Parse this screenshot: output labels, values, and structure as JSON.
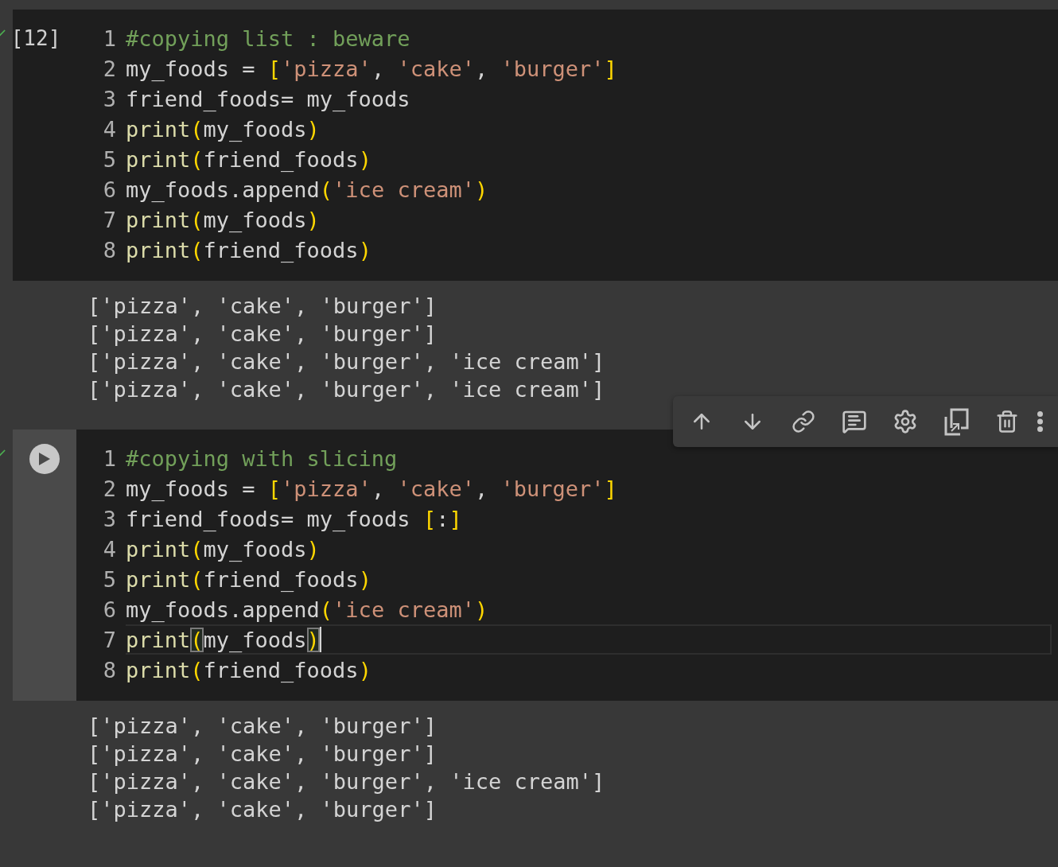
{
  "cells": [
    {
      "execution_count": "[12]",
      "run_button": false,
      "lines": [
        {
          "number": "1",
          "active": false,
          "cursor": false,
          "tokens": [
            {
              "kind": "comment",
              "text": "#copying list : beware"
            }
          ]
        },
        {
          "number": "2",
          "active": false,
          "cursor": false,
          "tokens": [
            {
              "kind": "plain",
              "text": "my_foods = "
            },
            {
              "kind": "bracket",
              "text": "["
            },
            {
              "kind": "string",
              "text": "'pizza'"
            },
            {
              "kind": "plain",
              "text": ", "
            },
            {
              "kind": "string",
              "text": "'cake'"
            },
            {
              "kind": "plain",
              "text": ", "
            },
            {
              "kind": "string",
              "text": "'burger'"
            },
            {
              "kind": "bracket",
              "text": "]"
            }
          ]
        },
        {
          "number": "3",
          "active": false,
          "cursor": false,
          "tokens": [
            {
              "kind": "plain",
              "text": "friend_foods= my_foods"
            }
          ]
        },
        {
          "number": "4",
          "active": false,
          "cursor": false,
          "tokens": [
            {
              "kind": "builtin",
              "text": "print"
            },
            {
              "kind": "bracket",
              "text": "("
            },
            {
              "kind": "plain",
              "text": "my_foods"
            },
            {
              "kind": "bracket",
              "text": ")"
            }
          ]
        },
        {
          "number": "5",
          "active": false,
          "cursor": false,
          "tokens": [
            {
              "kind": "builtin",
              "text": "print"
            },
            {
              "kind": "bracket",
              "text": "("
            },
            {
              "kind": "plain",
              "text": "friend_foods"
            },
            {
              "kind": "bracket",
              "text": ")"
            }
          ]
        },
        {
          "number": "6",
          "active": false,
          "cursor": false,
          "tokens": [
            {
              "kind": "plain",
              "text": "my_foods.append"
            },
            {
              "kind": "bracket",
              "text": "("
            },
            {
              "kind": "string",
              "text": "'ice cream'"
            },
            {
              "kind": "bracket",
              "text": ")"
            }
          ]
        },
        {
          "number": "7",
          "active": false,
          "cursor": false,
          "tokens": [
            {
              "kind": "builtin",
              "text": "print"
            },
            {
              "kind": "bracket",
              "text": "("
            },
            {
              "kind": "plain",
              "text": "my_foods"
            },
            {
              "kind": "bracket",
              "text": ")"
            }
          ]
        },
        {
          "number": "8",
          "active": false,
          "cursor": false,
          "tokens": [
            {
              "kind": "builtin",
              "text": "print"
            },
            {
              "kind": "bracket",
              "text": "("
            },
            {
              "kind": "plain",
              "text": "friend_foods"
            },
            {
              "kind": "bracket",
              "text": ")"
            }
          ]
        }
      ],
      "output": [
        "['pizza', 'cake', 'burger']",
        "['pizza', 'cake', 'burger']",
        "['pizza', 'cake', 'burger', 'ice cream']",
        "['pizza', 'cake', 'burger', 'ice cream']"
      ]
    },
    {
      "run_button": true,
      "lines": [
        {
          "number": "1",
          "active": false,
          "cursor": false,
          "tokens": [
            {
              "kind": "comment",
              "text": "#copying with slicing"
            }
          ]
        },
        {
          "number": "2",
          "active": false,
          "cursor": false,
          "tokens": [
            {
              "kind": "plain",
              "text": "my_foods = "
            },
            {
              "kind": "bracket",
              "text": "["
            },
            {
              "kind": "string",
              "text": "'pizza'"
            },
            {
              "kind": "plain",
              "text": ", "
            },
            {
              "kind": "string",
              "text": "'cake'"
            },
            {
              "kind": "plain",
              "text": ", "
            },
            {
              "kind": "string",
              "text": "'burger'"
            },
            {
              "kind": "bracket",
              "text": "]"
            }
          ]
        },
        {
          "number": "3",
          "active": false,
          "cursor": false,
          "tokens": [
            {
              "kind": "plain",
              "text": "friend_foods= my_foods "
            },
            {
              "kind": "bracket",
              "text": "["
            },
            {
              "kind": "plain",
              "text": ":"
            },
            {
              "kind": "bracket",
              "text": "]"
            }
          ]
        },
        {
          "number": "4",
          "active": false,
          "cursor": false,
          "tokens": [
            {
              "kind": "builtin",
              "text": "print"
            },
            {
              "kind": "bracket",
              "text": "("
            },
            {
              "kind": "plain",
              "text": "my_foods"
            },
            {
              "kind": "bracket",
              "text": ")"
            }
          ]
        },
        {
          "number": "5",
          "active": false,
          "cursor": false,
          "tokens": [
            {
              "kind": "builtin",
              "text": "print"
            },
            {
              "kind": "bracket",
              "text": "("
            },
            {
              "kind": "plain",
              "text": "friend_foods"
            },
            {
              "kind": "bracket",
              "text": ")"
            }
          ]
        },
        {
          "number": "6",
          "active": false,
          "cursor": false,
          "tokens": [
            {
              "kind": "plain",
              "text": "my_foods.append"
            },
            {
              "kind": "bracket",
              "text": "("
            },
            {
              "kind": "string",
              "text": "'ice cream'"
            },
            {
              "kind": "bracket",
              "text": ")"
            }
          ]
        },
        {
          "number": "7",
          "active": true,
          "cursor": true,
          "tokens": [
            {
              "kind": "builtin",
              "text": "print"
            },
            {
              "kind": "match",
              "text": "("
            },
            {
              "kind": "plain",
              "text": "my_foods"
            },
            {
              "kind": "match",
              "text": ")"
            }
          ]
        },
        {
          "number": "8",
          "active": false,
          "cursor": false,
          "tokens": [
            {
              "kind": "builtin",
              "text": "print"
            },
            {
              "kind": "bracket",
              "text": "("
            },
            {
              "kind": "plain",
              "text": "friend_foods"
            },
            {
              "kind": "bracket",
              "text": ")"
            }
          ]
        }
      ],
      "output": [
        "['pizza', 'cake', 'burger']",
        "['pizza', 'cake', 'burger']",
        "['pizza', 'cake', 'burger', 'ice cream']",
        "['pizza', 'cake', 'burger']"
      ]
    }
  ]
}
